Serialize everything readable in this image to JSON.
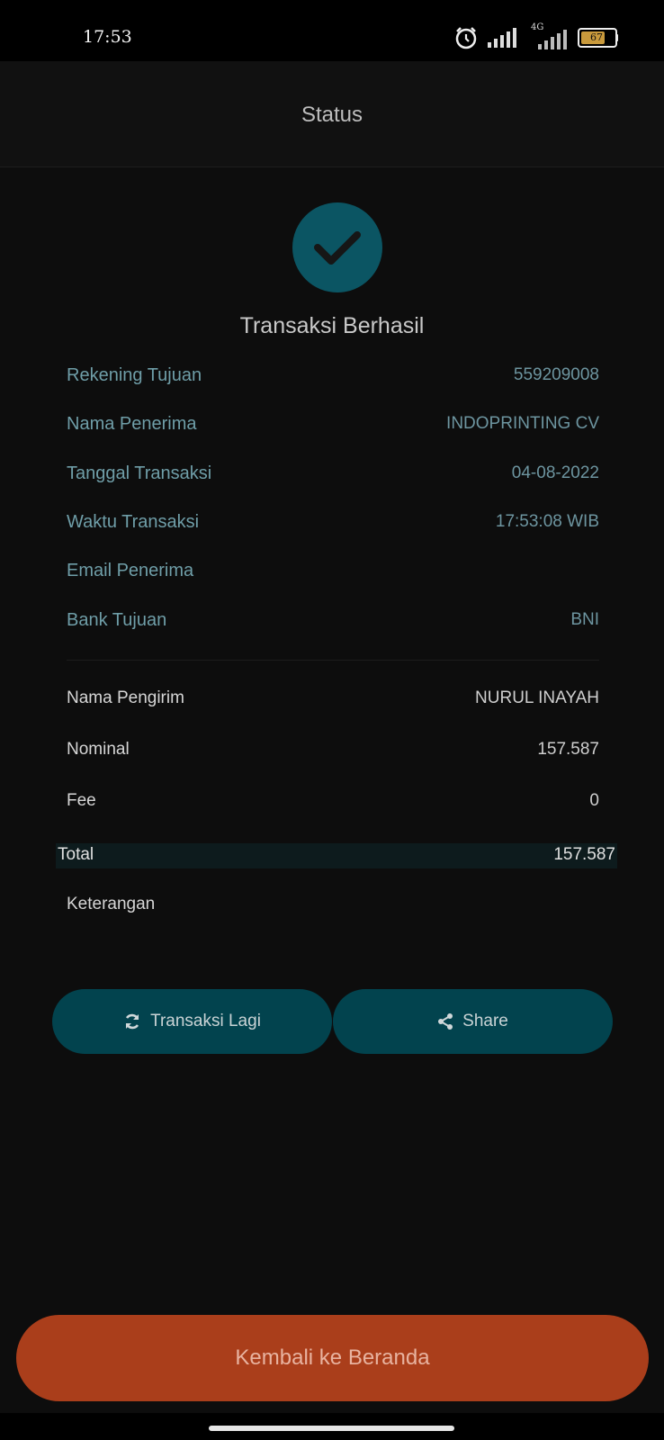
{
  "status_bar": {
    "time": "17:53",
    "network": "4G",
    "battery": "67"
  },
  "header": {
    "title": "Status"
  },
  "result": {
    "title": "Transaksi Berhasil"
  },
  "recipient": [
    {
      "label": "Rekening Tujuan",
      "value": "559209008"
    },
    {
      "label": "Nama Penerima",
      "value": "INDOPRINTING CV"
    },
    {
      "label": "Tanggal Transaksi",
      "value": "04-08-2022"
    },
    {
      "label": "Waktu Transaksi",
      "value": "17:53:08 WIB"
    },
    {
      "label": "Email Penerima",
      "value": ""
    },
    {
      "label": "Bank Tujuan",
      "value": "BNI"
    }
  ],
  "sender": [
    {
      "label": "Nama Pengirim",
      "value": "NURUL INAYAH"
    },
    {
      "label": "Nominal",
      "value": "157.587"
    },
    {
      "label": "Fee",
      "value": "0"
    }
  ],
  "total": {
    "label": "Total",
    "value": "157.587"
  },
  "note": {
    "label": "Keterangan",
    "value": ""
  },
  "buttons": {
    "again": "Transaksi Lagi",
    "share": "Share",
    "home": "Kembali ke Beranda"
  },
  "colors": {
    "accent_teal": "#02434e",
    "success_circle": "#0b5563",
    "home_button": "#aa3e1b"
  }
}
